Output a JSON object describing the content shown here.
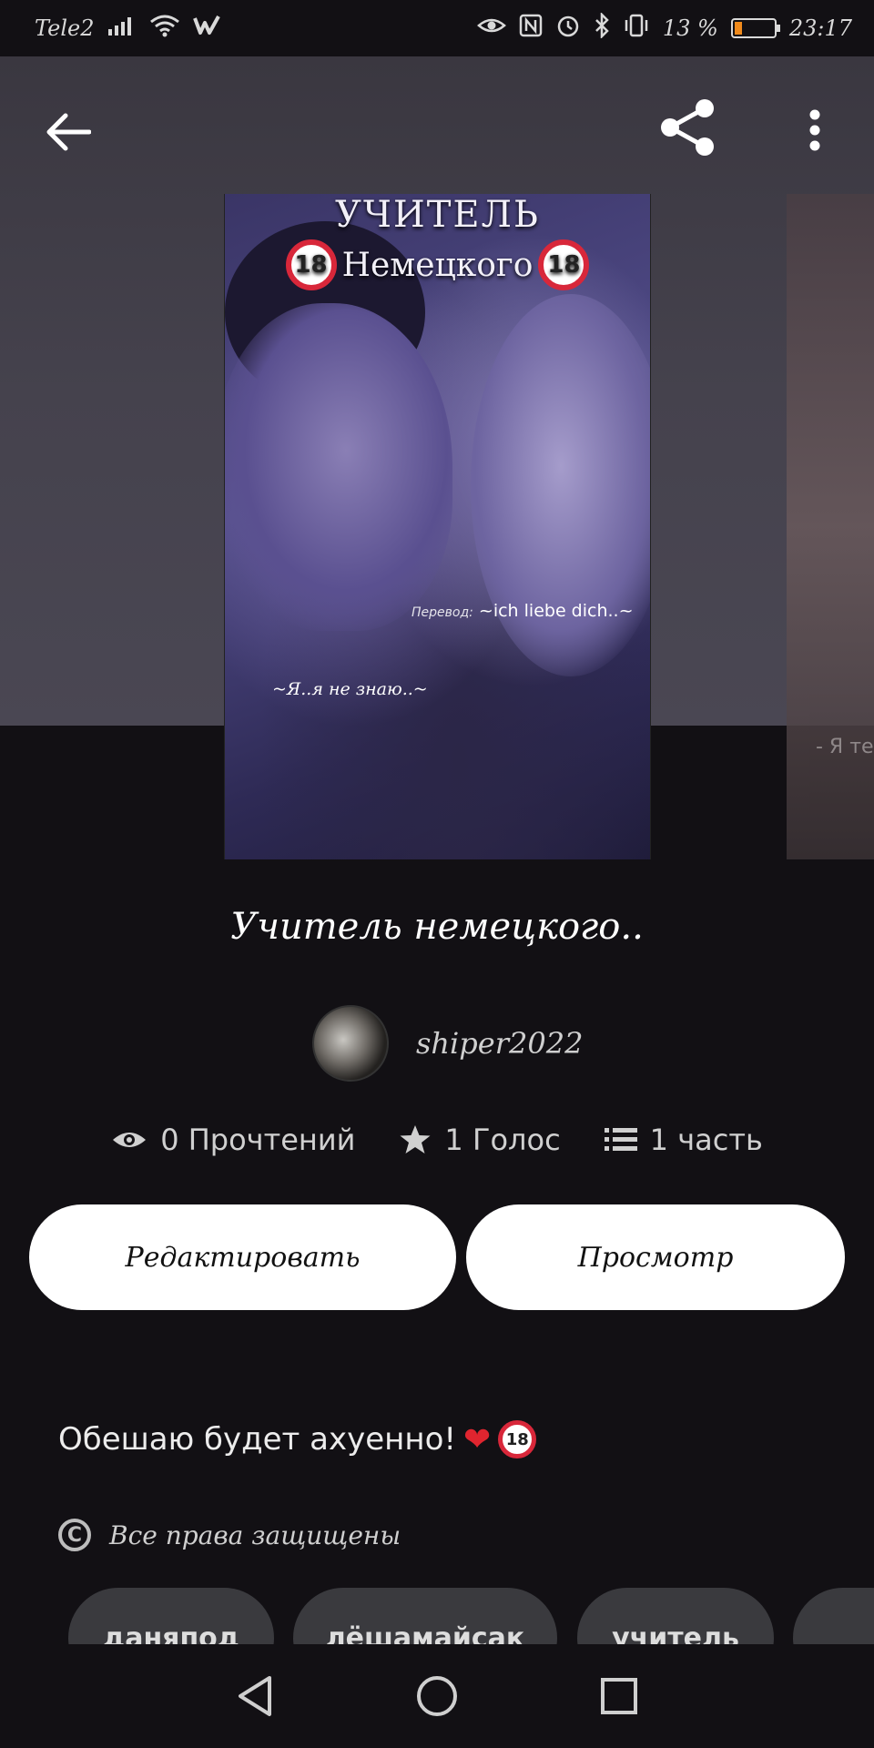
{
  "status_bar": {
    "carrier": "Tele2",
    "battery_percent": "13 %",
    "time": "23:17"
  },
  "cover": {
    "title_line1": "УЧИТЕЛЬ",
    "title_line2": "Немецкого",
    "badge": "18",
    "caption_translate_label": "Перевод:",
    "caption_translate_text": "~ich liebe dich..~",
    "caption_quote": "~Я..я не знаю..~"
  },
  "cover2": {
    "caption": "- Я те"
  },
  "story": {
    "title": "Учитель немецкого..",
    "author": "shiper2022"
  },
  "stats": {
    "reads": "0 Прочтений",
    "votes": "1 Голос",
    "parts": "1 часть"
  },
  "buttons": {
    "edit": "Редактировать",
    "view": "Просмотр"
  },
  "description": {
    "text": "Обешаю будет ахуенно!",
    "badge": "18"
  },
  "copyright": {
    "text": "Все права защищены"
  },
  "tags": [
    "даняпод",
    "лёшамайсак",
    "учитель"
  ],
  "colors": {
    "background": "#121014",
    "hero": "#45424d",
    "button_bg": "#ffffff",
    "tag_bg": "#3a3a3e",
    "badge_red": "#d8273a"
  }
}
